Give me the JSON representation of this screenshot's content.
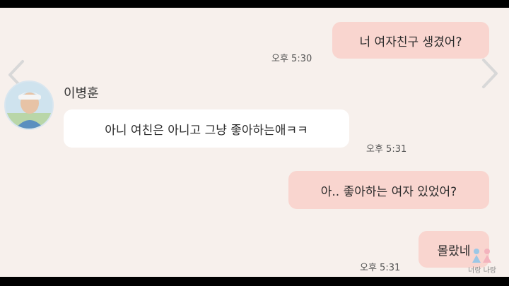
{
  "contact": {
    "name": "이병훈"
  },
  "messages": [
    {
      "id": "m1",
      "side": "out",
      "text": "너 여자친구 생겼어?",
      "time": "오후 5:30"
    },
    {
      "id": "m2",
      "side": "in",
      "text": "아니 여친은 아니고 그냥 좋아하는애ㅋㅋ",
      "time": "오후 5:31"
    },
    {
      "id": "m3",
      "side": "out",
      "text": "아.. 좋아하는 여자 있었어?",
      "time": ""
    },
    {
      "id": "m4",
      "side": "out",
      "text": "몰랐네",
      "time": "오후 5:31"
    }
  ],
  "watermark": {
    "text": "너랑 나랑"
  },
  "icons": {
    "prev": "chevron-left-icon",
    "next": "chevron-right-icon"
  },
  "colors": {
    "outgoing_bubble": "#f9d5cf",
    "incoming_bubble": "#ffffff",
    "background": "#f7f0ec"
  }
}
